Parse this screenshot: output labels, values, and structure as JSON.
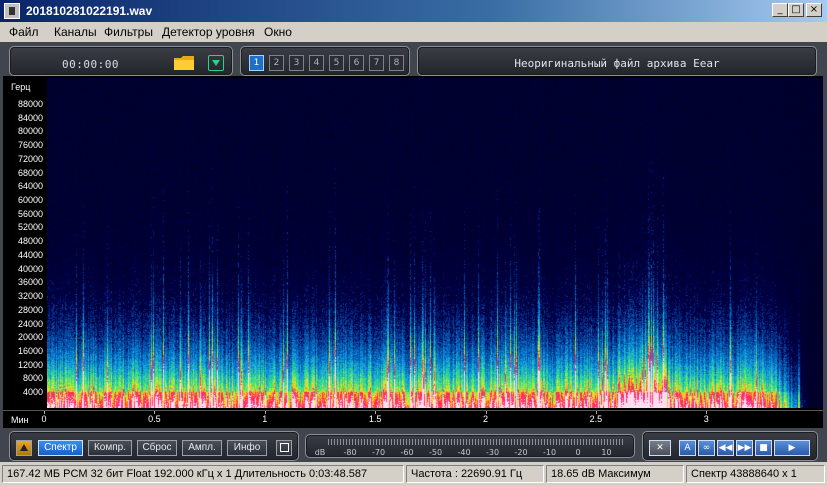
{
  "window": {
    "title": "201810281022191.wav",
    "minimize": "_",
    "maximize": "□",
    "close": "×"
  },
  "menu": [
    "Файл",
    "Каналы",
    "Фильтры",
    "Детектор уровня",
    "Окно"
  ],
  "toolbar": {
    "time": "00:00:00",
    "folder_icon": "folder-icon",
    "dropdown_icon": "dropdown-arrow-icon",
    "channels": [
      "1",
      "2",
      "3",
      "4",
      "5",
      "6",
      "7",
      "8"
    ],
    "active_channel": "1",
    "info_message": "Неоригинальный файл архива Eear"
  },
  "spectrogram": {
    "y_unit": "Герц",
    "y_ticks": [
      "88000",
      "84000",
      "80000",
      "76000",
      "72000",
      "68000",
      "64000",
      "60000",
      "56000",
      "52000",
      "48000",
      "44000",
      "40000",
      "36000",
      "32000",
      "28000",
      "24000",
      "20000",
      "16000",
      "12000",
      "8000",
      "4000"
    ],
    "x_unit": "Мин",
    "x_ticks": [
      "0",
      "0.5",
      "1",
      "1.5",
      "2",
      "2.5",
      "3"
    ],
    "x_max_minutes": 3.48,
    "colors": {
      "background": "#000050",
      "low": "#0a1a8a",
      "mid": "#1aa0e0",
      "high": "#f0e020",
      "peak": "#ff1060",
      "max": "#ffffff"
    }
  },
  "bottom_toolbar": {
    "buttons": [
      "Спектр",
      "Компр.",
      "Сброс",
      "Ампл.",
      "Инфо"
    ],
    "active_button": "Спектр",
    "meter_unit": "dB",
    "meter_scale": [
      "-80",
      "-70",
      "-60",
      "-50",
      "-40",
      "-30",
      "-20",
      "-10",
      "0",
      "10"
    ],
    "playback": [
      "✕",
      "A",
      "∞",
      "◀◀",
      "▶▶",
      "■",
      "▶"
    ]
  },
  "status": {
    "file_info": "167.42 МБ PCM 32 бит Float 192.000 кГц x 1  Длительность 0:03:48.587",
    "frequency": "Частота : 22690.91 Гц",
    "level": "18.65 dB Максимум",
    "spectrum": "Спектр 43888640 x 1"
  }
}
